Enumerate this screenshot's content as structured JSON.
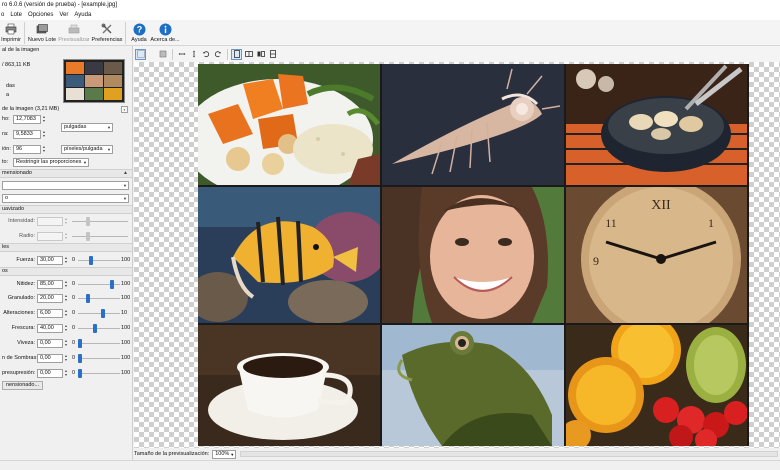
{
  "window": {
    "title": "ro 6.0.6 (versión de prueba) - [example.jpg]"
  },
  "menu": [
    "o",
    "Lote",
    "Opciones",
    "Ver",
    "Ayuda"
  ],
  "toolbar": {
    "items": [
      {
        "label": "Imprimir",
        "icon": "printer-icon",
        "enabled": true
      },
      {
        "label": "Nuevo Lote",
        "icon": "batch-icon",
        "enabled": true
      },
      {
        "label": "Previsualizar",
        "icon": "preview-icon",
        "enabled": false
      },
      {
        "label": "Preferencias",
        "icon": "tools-icon",
        "enabled": true
      },
      {
        "label": "Ayuda",
        "icon": "help-icon",
        "enabled": true
      },
      {
        "label": "Acerca de...",
        "icon": "info-icon",
        "enabled": true
      }
    ]
  },
  "panel": {
    "original_label": "al de la imagen",
    "original_size": "/ 863,11 KB",
    "option_1": "das",
    "option_2": "a",
    "new_size_label": "de la imagen (3,21 MB)",
    "width_label": "ho:",
    "width_value": "12,7083",
    "height_label": "ra:",
    "height_value": "9,5833",
    "unit_value": "pulgadas",
    "resolution_label": "ión:",
    "resolution_value": "96",
    "resolution_unit": "píxeles/pulgada",
    "aspect_label": "to:",
    "aspect_value": "Restringir las proporciones",
    "resample_label": "mensionado",
    "filter_combo": "",
    "method_combo": "o",
    "sharpen_group": "uavizado",
    "intensity_label": "Intensidad:",
    "radius_label": "Radio:",
    "noise_group": "les",
    "strength_label": "Fuerza:",
    "strength_value": "30,00",
    "strength_min": "0",
    "strength_max": "100",
    "strength_level": 0.3,
    "quality_group": "os",
    "sharpness_label": "Nitidez:",
    "sharpness_value": "85,00",
    "sharpness_min": "0",
    "sharpness_max": "100",
    "sharpness_level": 0.85,
    "grain_label": "Granulado:",
    "grain_value": "20,00",
    "grain_min": "0",
    "grain_max": "100",
    "grain_level": 0.2,
    "artifacts_label": "Alteraciones:",
    "artifacts_value": "6,00",
    "artifacts_min": "0",
    "artifacts_max": "10",
    "artifacts_level": 0.6,
    "fresh_label": "Frescura:",
    "fresh_value": "40,00",
    "fresh_min": "0",
    "fresh_max": "100",
    "fresh_level": 0.4,
    "vivid_label": "Viveza:",
    "vivid_value": "0,00",
    "vivid_min": "0",
    "vivid_max": "100",
    "vivid_level": 0.0,
    "shadows_label": "n de Sombras:",
    "shadows_value": "0,00",
    "shadows_min": "0",
    "shadows_max": "100",
    "shadows_level": 0.0,
    "precompress_label": "presupresión:",
    "precompress_value": "0,00",
    "precompress_min": "0",
    "precompress_max": "100",
    "precompress_level": 0.0,
    "resample_button": "nensionado..."
  },
  "statusbar": {
    "preview_size_label": "Tamaño de la previsualización:",
    "zoom_value": "100%"
  },
  "colors": {
    "accent": "#2a70c8",
    "help": "#1e6fc4"
  }
}
